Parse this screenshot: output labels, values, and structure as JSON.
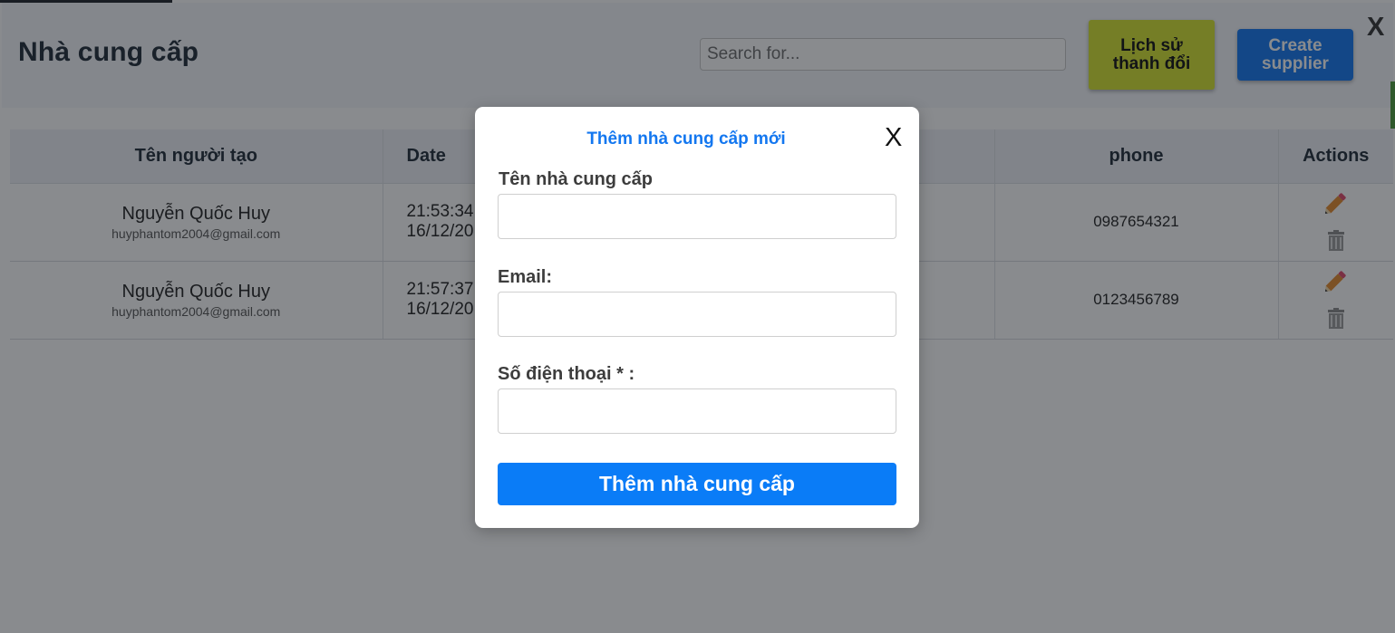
{
  "header": {
    "title": "Nhà cung cấp",
    "search_placeholder": "Search for...",
    "history_button": "Lịch sử thanh đổi",
    "create_button": "Create supplier",
    "close_label": "X"
  },
  "table": {
    "columns": [
      "Tên người tạo",
      "Date",
      "phone",
      "Actions"
    ],
    "rows": [
      {
        "creator_name": "Nguyễn Quốc Huy",
        "creator_email": "huyphantom2004@gmail.com",
        "time": "21:53:34",
        "date": "16/12/20",
        "phone": "0987654321"
      },
      {
        "creator_name": "Nguyễn Quốc Huy",
        "creator_email": "huyphantom2004@gmail.com",
        "time": "21:57:37",
        "date": "16/12/20",
        "phone": "0123456789"
      }
    ],
    "action_icons": [
      "pencil-icon",
      "trash-icon"
    ]
  },
  "modal": {
    "title": "Thêm nhà cung cấp mới",
    "close_label": "X",
    "fields": [
      {
        "label": "Tên nhà cung cấp",
        "value": ""
      },
      {
        "label": "Email:",
        "value": ""
      },
      {
        "label": "Số điện thoại * :",
        "value": ""
      }
    ],
    "submit_label": "Thêm nhà cung cấp"
  },
  "colors": {
    "primary": "#1377f0",
    "history_button": "#d7e52f",
    "submit": "#0a7cf7",
    "overlay": "rgba(20,24,30,0.5)"
  }
}
